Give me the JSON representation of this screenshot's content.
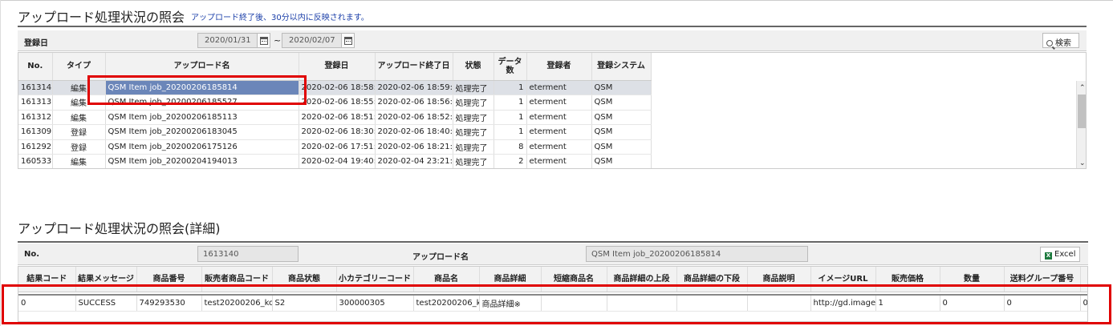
{
  "section1": {
    "title": "アップロード処理状況の照会",
    "note": "アップロード終了後、30分以内に反映されます。",
    "filter": {
      "label": "登録日",
      "date_from": "2020/01/31",
      "separator": "~",
      "date_to": "2020/02/07",
      "search_label": "検索"
    },
    "columns": [
      "No.",
      "タイプ",
      "アップロード名",
      "登録日",
      "アップロード終了日",
      "状態",
      "データ数",
      "登録者",
      "登録システム"
    ],
    "rows": [
      [
        "161314",
        "編集",
        "QSM Item job_20200206185814",
        "2020-02-06 18:58:1",
        "2020-02-06 18:59:0",
        "処理完了",
        "1",
        "eterment",
        "QSM"
      ],
      [
        "161313",
        "編集",
        "QSM Item job_20200206185527",
        "2020-02-06 18:55:2",
        "2020-02-06 18:56:0",
        "処理完了",
        "1",
        "eterment",
        "QSM"
      ],
      [
        "161312",
        "編集",
        "QSM Item job_20200206185113",
        "2020-02-06 18:51:1",
        "2020-02-06 18:52:0",
        "処理完了",
        "1",
        "eterment",
        "QSM"
      ],
      [
        "161309",
        "登録",
        "QSM Item job_20200206183045",
        "2020-02-06 18:30:4",
        "2020-02-06 18:40:0",
        "処理完了",
        "1",
        "eterment",
        "QSM"
      ],
      [
        "161292",
        "登録",
        "QSM Item job_20200206175126",
        "2020-02-06 17:51:2",
        "2020-02-06 18:21:3",
        "処理完了",
        "8",
        "eterment",
        "QSM"
      ],
      [
        "160533",
        "編集",
        "QSM Item job_20200204194013",
        "2020-02-04 19:40:1",
        "2020-02-04 23:21:3",
        "処理完了",
        "2",
        "eterment",
        "QSM"
      ]
    ]
  },
  "section2": {
    "title": "アップロード処理状況の照会(詳細)",
    "no_label": "No.",
    "no_value": "1613140",
    "upload_name_label": "アップロード名",
    "upload_name_value": "QSM Item job_20200206185814",
    "excel_label": "Excel",
    "columns": [
      "結果コード",
      "結果メッセージ",
      "商品番号",
      "販売者商品コード",
      "商品状態",
      "小カテゴリーコード",
      "商品名",
      "商品詳細",
      "短縮商品名",
      "商品詳細の上段",
      "商品詳細の下段",
      "商品説明",
      "イメージURL",
      "販売価格",
      "数量",
      "送料グループ番号",
      ""
    ],
    "rows": [
      [
        "0",
        "SUCCESS",
        "749293530",
        "test20200206_ko",
        "S2",
        "300000305",
        "test20200206_ko",
        "商品詳細※",
        "",
        "",
        "",
        "",
        "http://gd.image-",
        "1",
        "0",
        "0",
        "0"
      ]
    ]
  }
}
